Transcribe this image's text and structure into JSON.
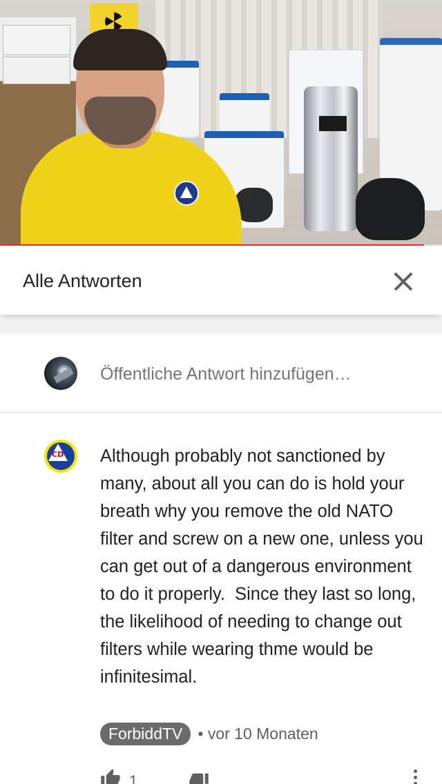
{
  "video": {
    "progress_fraction": 0.96,
    "progress_color": "#e52d27"
  },
  "header": {
    "title": "Alle Antworten",
    "close_icon": "close-icon"
  },
  "reply": {
    "placeholder": "Öffentliche Antwort hinzufügen…"
  },
  "comment": {
    "text": "Although probably not sanctioned by many, about all you can do is hold your breath why you remove the old NATO filter and screw on a new one, unless you can get out of a dangerous environment to do it properly.  Since they last so long, the likelihood of needing to change out filters while wearing thme would be infinitesimal.",
    "author": "ForbiddTV",
    "separator": "•",
    "time": "vor 10 Monaten",
    "like_count": "1",
    "avatar_text": "CD"
  },
  "colors": {
    "author_chip": "#6b6b6b",
    "accent_red": "#e52d27",
    "cd_yellow": "#f5e600",
    "cd_blue": "#1c3f9b"
  }
}
